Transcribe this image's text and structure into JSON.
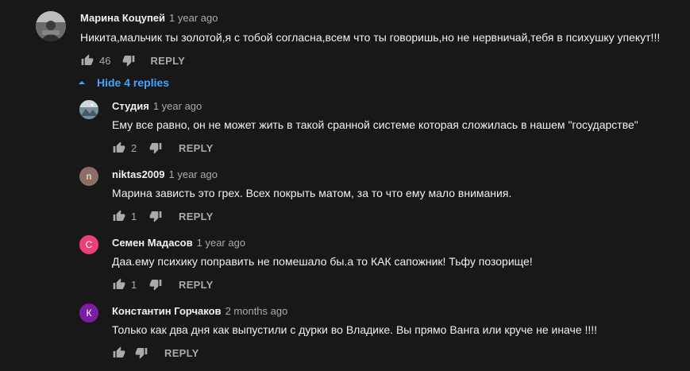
{
  "main_comment": {
    "author": "Марина Коцупей",
    "time": "1 year ago",
    "text": "Никита,мальчик ты золотой,я с тобой согласна,всем что ты говоришь,но не нервничай,тебя в психушку упекут!!!",
    "likes": "46",
    "reply_label": "REPLY"
  },
  "replies_toggle": {
    "label": "Hide 4 replies"
  },
  "replies": [
    {
      "author": "Студия",
      "time": "1 year ago",
      "text": "Ему все равно, он не может жить в такой сранной системе которая сложилась в нашем \"государстве\"",
      "likes": "2",
      "reply_label": "REPLY"
    },
    {
      "author": "niktas2009",
      "time": "1 year ago",
      "text": "Марина зависть это грех. Всех покрыть матом, за то что ему мало внимания.",
      "likes": "1",
      "reply_label": "REPLY",
      "avatar_letter": "n",
      "avatar_color": "#8d6e63"
    },
    {
      "author": "Семен Мадасов",
      "time": "1 year ago",
      "text": "Даа.ему психику поправить не помешало бы.а то КАК  сапожник! Тьфу позорище!",
      "likes": "1",
      "reply_label": "REPLY",
      "avatar_letter": "С",
      "avatar_color": "#ec407a"
    },
    {
      "author": "Константин Горчаков",
      "time": "2 months ago",
      "text": "Только как два дня как выпустили с дурки во Владике. Вы прямо Ванга или круче не иначе !!!!",
      "likes": "",
      "reply_label": "REPLY",
      "avatar_letter": "К",
      "avatar_color": "#7b1fa2"
    }
  ]
}
